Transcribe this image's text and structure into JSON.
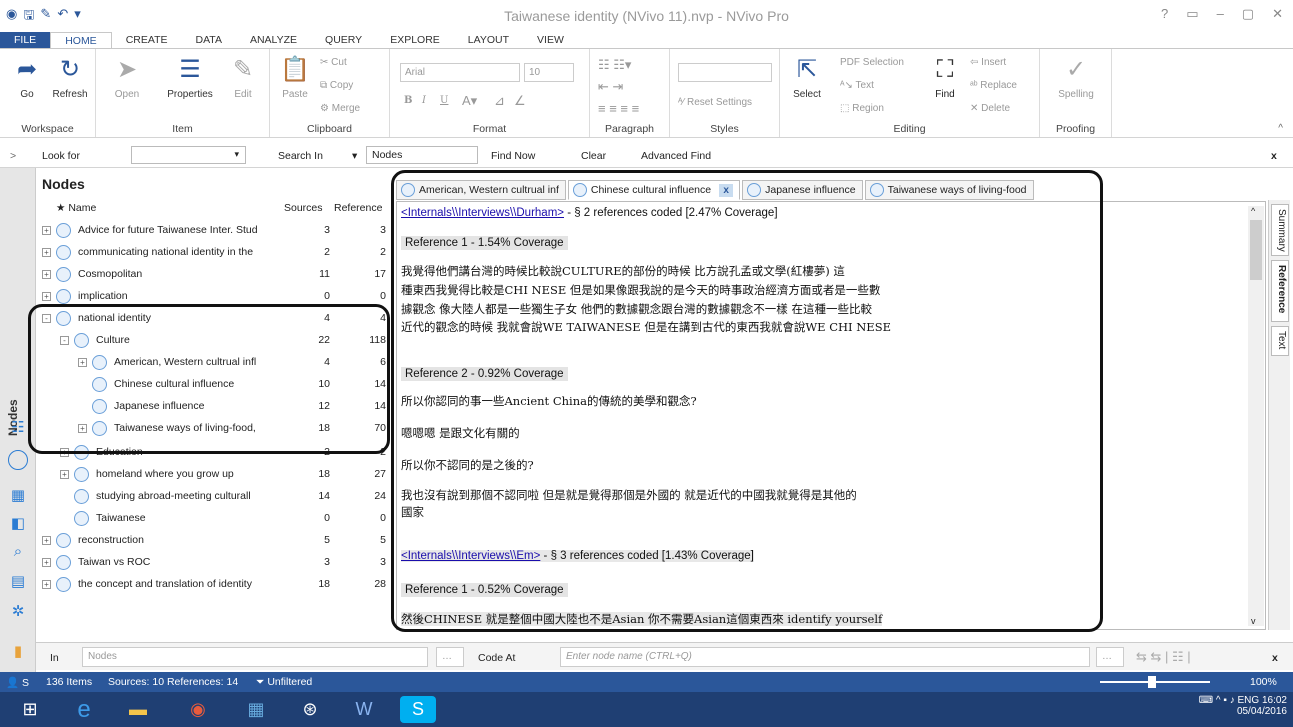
{
  "window": {
    "title": "Taiwanese identity (NVivo 11).nvp - NVivo Pro",
    "controls": [
      "?",
      "▭",
      "–",
      "▢",
      "✕"
    ]
  },
  "quick_access": {
    "icons": [
      "nvivo-logo-icon",
      "save-icon",
      "edit-icon",
      "undo-icon",
      "customize-icon"
    ]
  },
  "menu": [
    "FILE",
    "HOME",
    "CREATE",
    "DATA",
    "ANALYZE",
    "QUERY",
    "EXPLORE",
    "LAYOUT",
    "VIEW"
  ],
  "ribbon": {
    "workspace": {
      "label": "Workspace",
      "go": "Go",
      "refresh": "Refresh"
    },
    "item": {
      "label": "Item",
      "open": "Open",
      "properties": "Properties",
      "edit": "Edit"
    },
    "clipboard": {
      "label": "Clipboard",
      "paste": "Paste",
      "cut": "Cut",
      "copy": "Copy",
      "merge": "Merge"
    },
    "format": {
      "label": "Format",
      "font": "Arial",
      "size": "10",
      "bold": "B",
      "italic": "I",
      "underline": "U"
    },
    "paragraph": {
      "label": "Paragraph"
    },
    "styles": {
      "label": "Styles",
      "reset": "Reset Settings"
    },
    "editing": {
      "label": "Editing",
      "select": "Select",
      "pdf_selection": "PDF Selection",
      "text": "Text",
      "region": "Region",
      "find": "Find",
      "insert": "Insert",
      "replace": "Replace",
      "delete": "Delete"
    },
    "proofing": {
      "label": "Proofing",
      "spelling": "Spelling"
    }
  },
  "findbar": {
    "look_for": "Look for",
    "search_in": "Search In",
    "scope": "Nodes",
    "find_now": "Find Now",
    "clear": "Clear",
    "advanced": "Advanced Find",
    "close": "x"
  },
  "left_nav": {
    "label": "Nodes"
  },
  "nodes": {
    "title": "Nodes",
    "columns": {
      "name": "Name",
      "sources": "Sources",
      "references": "Reference"
    },
    "rows": [
      {
        "name": "Advice for future Taiwanese Inter. Stud",
        "sources": "3",
        "refs": "3",
        "level": 0,
        "exp": "+"
      },
      {
        "name": "communicating national identity in the",
        "sources": "2",
        "refs": "2",
        "level": 0,
        "exp": "+"
      },
      {
        "name": "Cosmopolitan",
        "sources": "11",
        "refs": "17",
        "level": 0,
        "exp": "+"
      },
      {
        "name": "implication",
        "sources": "0",
        "refs": "0",
        "level": 0,
        "exp": "+"
      },
      {
        "name": "national identity",
        "sources": "4",
        "refs": "4",
        "level": 0,
        "exp": "-"
      },
      {
        "name": "Culture",
        "sources": "22",
        "refs": "118",
        "level": 1,
        "exp": "-"
      },
      {
        "name": "American, Western cultrual infl",
        "sources": "4",
        "refs": "6",
        "level": 2,
        "exp": "+"
      },
      {
        "name": "Chinese cultural influence",
        "sources": "10",
        "refs": "14",
        "level": 2,
        "exp": ""
      },
      {
        "name": "Japanese influence",
        "sources": "12",
        "refs": "14",
        "level": 2,
        "exp": ""
      },
      {
        "name": "Taiwanese ways of living-food,",
        "sources": "18",
        "refs": "70",
        "level": 2,
        "exp": "+"
      },
      {
        "name": "Education",
        "sources": "2",
        "refs": "2",
        "level": 1,
        "exp": "+"
      },
      {
        "name": "homeland where you grow up",
        "sources": "18",
        "refs": "27",
        "level": 1,
        "exp": "+"
      },
      {
        "name": "studying abroad-meeting culturall",
        "sources": "14",
        "refs": "24",
        "level": 1,
        "exp": ""
      },
      {
        "name": "Taiwanese",
        "sources": "0",
        "refs": "0",
        "level": 1,
        "exp": ""
      },
      {
        "name": "reconstruction",
        "sources": "5",
        "refs": "5",
        "level": 0,
        "exp": "+"
      },
      {
        "name": "Taiwan vs ROC",
        "sources": "3",
        "refs": "3",
        "level": 0,
        "exp": "+"
      },
      {
        "name": "the concept and translation of identity",
        "sources": "18",
        "refs": "28",
        "level": 0,
        "exp": "+"
      }
    ]
  },
  "tabs": [
    {
      "label": "American, Western cultrual inf",
      "active": false
    },
    {
      "label": "Chinese cultural influence",
      "active": true
    },
    {
      "label": "Japanese influence",
      "active": false
    },
    {
      "label": "Taiwanese ways of living-food",
      "active": false
    }
  ],
  "detail": {
    "src1_link": "<Internals\\\\Interviews\\\\Durham>",
    "src1_rest": " - § 2 references coded  [2.47% Coverage]",
    "ref1": "Reference 1 - 1.54% Coverage",
    "p1": [
      "我覺得他們講台灣的時候比較說CULTURE的部份的時候 比方說孔孟或文學(紅樓夢) 這",
      "種東西我覺得比較是CHI NESE  但是如果像跟我說的是今天的時事政治經濟方面或者是一些數",
      "據觀念 像大陸人都是一些獨生子女 他們的數據觀念跟台灣的數據觀念不一樣 在這種一些比較",
      "近代的觀念的時候 我就會說WE TAIWANESE 但是在講到古代的東西我就會說WE  CHI NESE"
    ],
    "ref2": "Reference 2 - 0.92% Coverage",
    "p2": "所以你認同的事一些Ancient China的傳統的美學和觀念?",
    "p3": "嗯嗯嗯 是跟文化有關的",
    "p4": "所以你不認同的是之後的?",
    "p5": [
      "我也沒有說到那個不認同啦 但是就是覺得那個是外國的 就是近代的中國我就覺得是其他的",
      "國家"
    ],
    "src2_link": "<Internals\\\\Interviews\\\\Em>",
    "src2_rest": " - § 3 references coded  [1.43% Coverage]",
    "ref3": "Reference 1 - 0.52% Coverage",
    "p6": "然後CHINESE 就是整個中國大陸也不是Asian 你不需要Asian這個東西來 identify yourself"
  },
  "right_tabs": [
    "Summary",
    "Reference",
    "Text"
  ],
  "codebar": {
    "in": "In",
    "in_value": "Nodes",
    "code_at": "Code At",
    "placeholder": "Enter node name (CTRL+Q)",
    "close": "x"
  },
  "status": {
    "user": "S",
    "items": "136 Items",
    "counts": "Sources: 10  References: 14",
    "filter": "Unfiltered",
    "zoom": "100%"
  },
  "tray": {
    "lang": "ENG",
    "time": "16:02",
    "date": "05/04/2016"
  }
}
